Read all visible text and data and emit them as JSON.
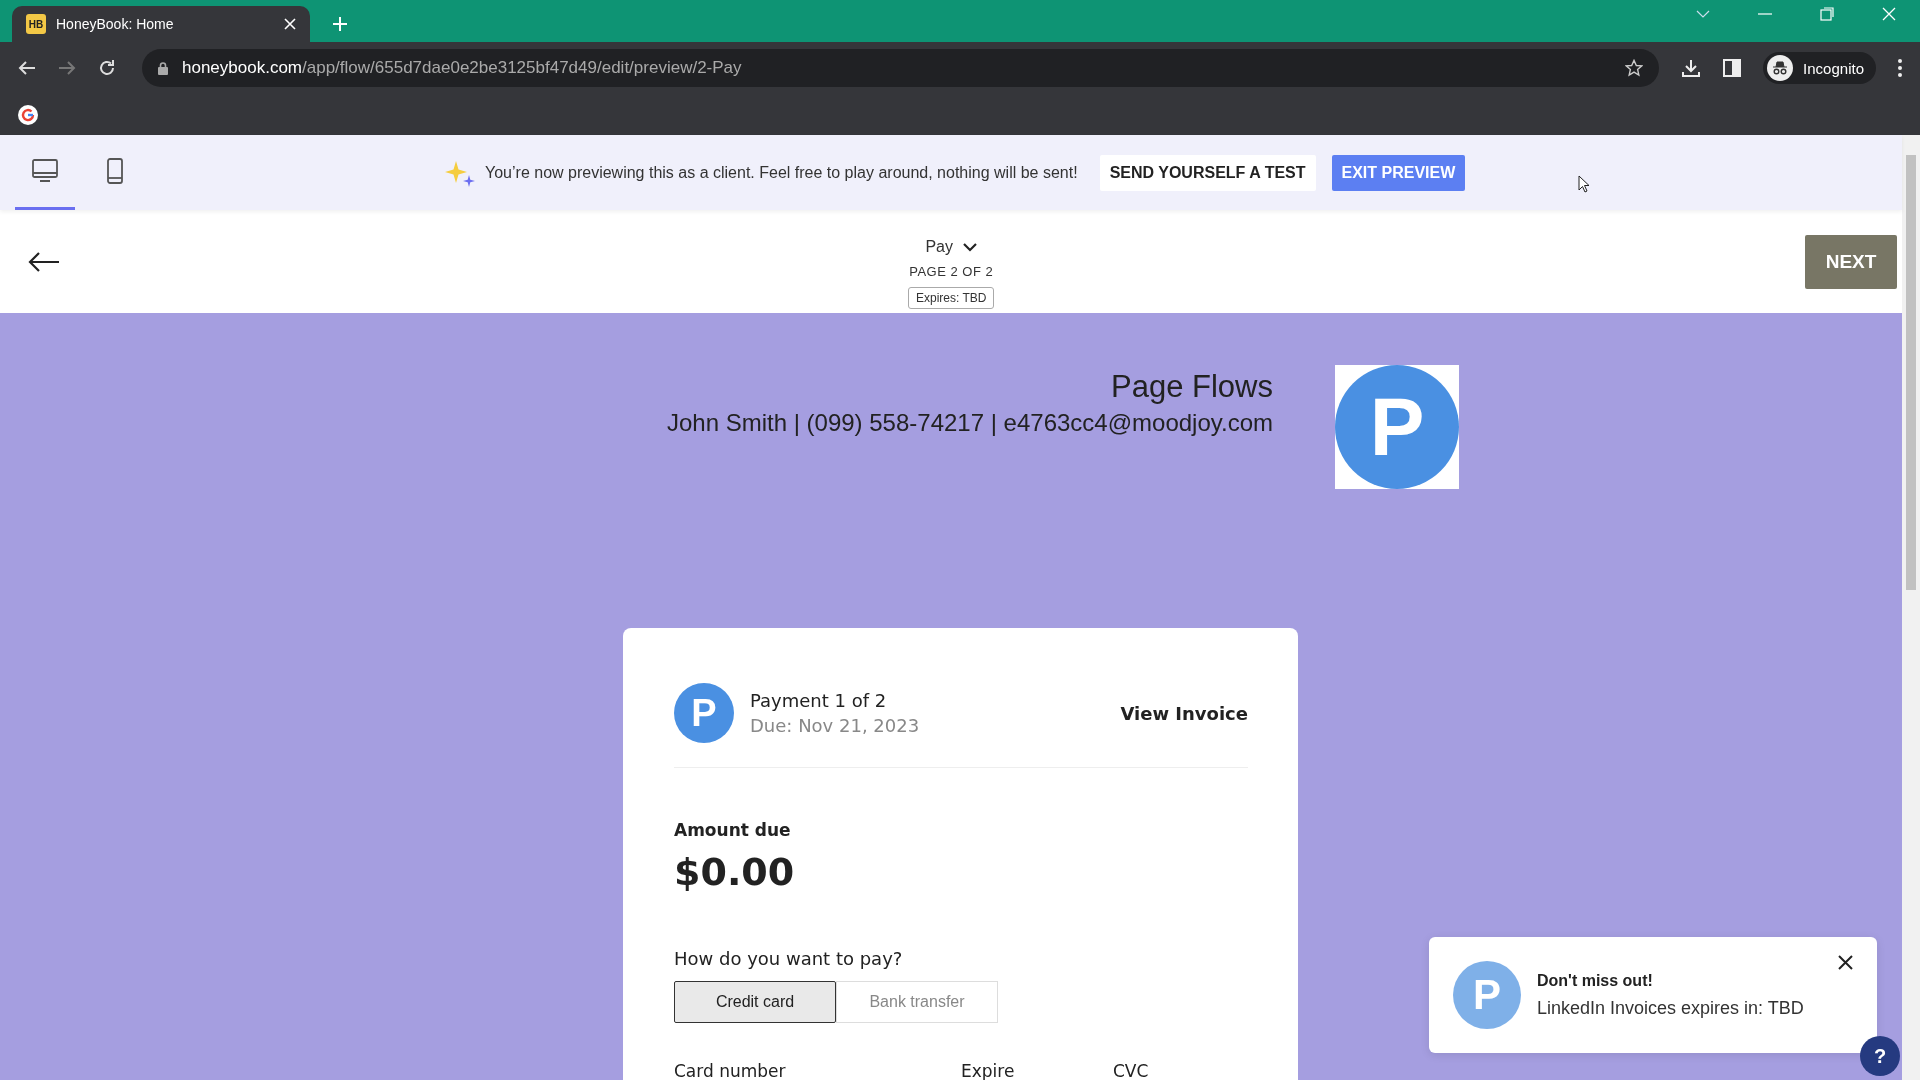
{
  "browser": {
    "tab": {
      "title": "HoneyBook: Home",
      "favicon": "HB"
    },
    "url_host": "honeybook.com",
    "url_path": "/app/flow/655d7dae0e2be3125bf47d49/edit/preview/2-Pay",
    "profile": "Incognito"
  },
  "preview_bar": {
    "devices": [
      {
        "kind": "desktop",
        "selected": true
      },
      {
        "kind": "mobile",
        "selected": false
      }
    ],
    "message": "You’re now previewing this as a client. Feel free to play around, nothing will be sent!",
    "buttons": [
      {
        "label": "SEND YOURSELF A TEST",
        "kind": "secondary"
      },
      {
        "label": "EXIT PREVIEW",
        "kind": "primary"
      }
    ]
  },
  "page_header": {
    "page_name": "Pay",
    "page_count": "PAGE 2 OF 2",
    "expires": "Expires: TBD",
    "next": "NEXT"
  },
  "company": {
    "name": "Page Flows",
    "contact": "John Smith | (099) 558-74217 | e4763cc4@moodjoy.com",
    "logo_letter": "P"
  },
  "payment": {
    "avatar_letter": "P",
    "title": "Payment 1 of 2",
    "due": "Due: Nov 21, 2023",
    "view_invoice": "View Invoice",
    "amount_label": "Amount due",
    "amount": "$0.00",
    "method_question": "How do you want to pay?",
    "methods": [
      {
        "label": "Credit card",
        "selected": true
      },
      {
        "label": "Bank transfer",
        "selected": false
      }
    ],
    "fields": [
      "Card number",
      "Expire",
      "CVC"
    ]
  },
  "toast": {
    "avatar_letter": "P",
    "title": "Don't miss out!",
    "message": "LinkedIn Invoices expires in: TBD"
  },
  "help": "?"
}
